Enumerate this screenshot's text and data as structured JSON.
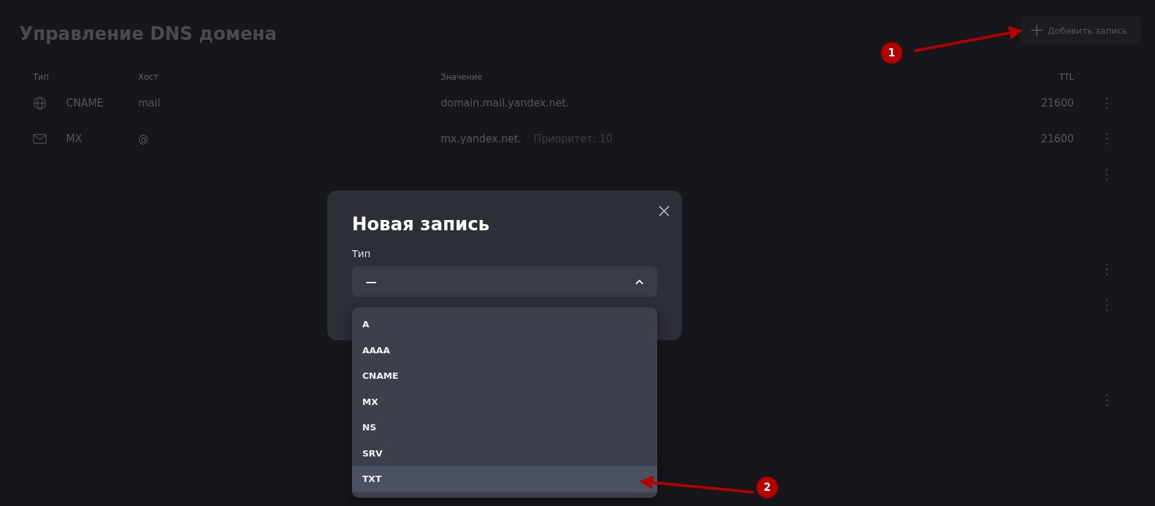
{
  "page": {
    "title": "Управление DNS домена",
    "add_button": "Добавить запись"
  },
  "table": {
    "columns": [
      "Тип",
      "Хост",
      "Значение",
      "TTL"
    ],
    "rows": [
      {
        "kind": "record",
        "type": "CNAME",
        "host": "mail",
        "value": "domain.mail.yandex.net.",
        "ttl": "21600"
      },
      {
        "kind": "record",
        "type": "MX",
        "host": "@",
        "value": "mx.yandex.net.",
        "extra": "Приоритет: 10",
        "ttl": "21600"
      },
      {
        "kind": "blank"
      },
      {
        "kind": "gap"
      },
      {
        "kind": "blank"
      },
      {
        "kind": "blank"
      },
      {
        "kind": "gap"
      },
      {
        "kind": "blank"
      }
    ]
  },
  "dialog": {
    "title": "Новая запись",
    "field_label": "Тип",
    "value": "—",
    "expanded": true,
    "options": [
      {
        "label": "A",
        "selected": false
      },
      {
        "label": "AAAA",
        "selected": false
      },
      {
        "label": "CNAME",
        "selected": false
      },
      {
        "label": "MX",
        "selected": false
      },
      {
        "label": "NS",
        "selected": false
      },
      {
        "label": "SRV",
        "selected": false
      },
      {
        "label": "TXT",
        "selected": true
      }
    ]
  },
  "annotations": [
    {
      "label": "1"
    },
    {
      "label": "2"
    }
  ]
}
